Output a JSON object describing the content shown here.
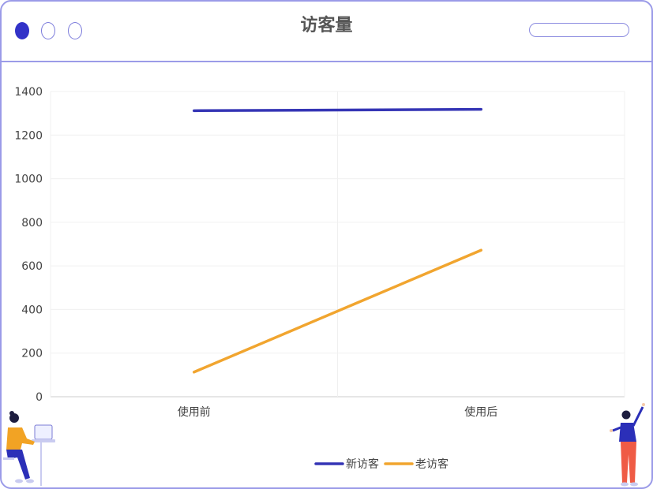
{
  "window": {
    "title": "访客量",
    "controls": [
      "dot-filled",
      "dot-hollow",
      "dot-hollow"
    ],
    "accent": "#3232c8",
    "border_color": "#9b9be8"
  },
  "chart_data": {
    "type": "line",
    "categories": [
      "使用前",
      "使用后"
    ],
    "series": [
      {
        "name": "新访客",
        "values": [
          1312,
          1318
        ],
        "color": "#3535b5"
      },
      {
        "name": "老访客",
        "values": [
          113,
          672
        ],
        "color": "#f1a52f"
      }
    ],
    "ylim": [
      0,
      1400
    ],
    "yticks": [
      0,
      200,
      400,
      600,
      800,
      1000,
      1200,
      1400
    ],
    "grid": true,
    "legend": "bottom-center"
  }
}
